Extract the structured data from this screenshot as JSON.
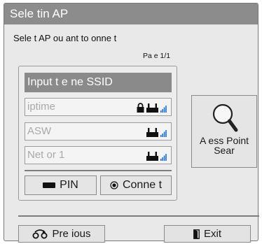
{
  "dialog": {
    "title": "Sele tin  AP",
    "instruction": "Sele t AP ou  ant to  onne t",
    "page_indicator": "Pa e  1/1"
  },
  "ssid_input": {
    "placeholder_text": "Input t e ne  SSID"
  },
  "networks": [
    {
      "name": "iptime",
      "secured": true,
      "icons": [
        "lock-icon",
        "router-icon",
        "signal-icon"
      ]
    },
    {
      "name": "ASW",
      "secured": false,
      "icons": [
        "router-icon",
        "signal-icon"
      ]
    },
    {
      "name": "Net or 1",
      "secured": false,
      "icons": [
        "router-icon",
        "signal-icon"
      ]
    }
  ],
  "buttons": {
    "pin": {
      "label": "PIN",
      "icon": "pin-key-icon"
    },
    "connect": {
      "label": "Conne t",
      "icon": "ok-button-icon"
    },
    "ap_search": {
      "label_line1": "A  ess Point",
      "label_line2": "Sear",
      "icon": "magnifier-icon"
    },
    "previous": {
      "label": "Pre ious",
      "icon": "back-arrow-icon"
    },
    "exit": {
      "label": "Exit",
      "icon": "exit-door-icon"
    }
  },
  "colors": {
    "title_bar": "#8c8c8c",
    "dialog_bg": "#e9e9e9",
    "signal_blue": "#1f6fd1"
  }
}
